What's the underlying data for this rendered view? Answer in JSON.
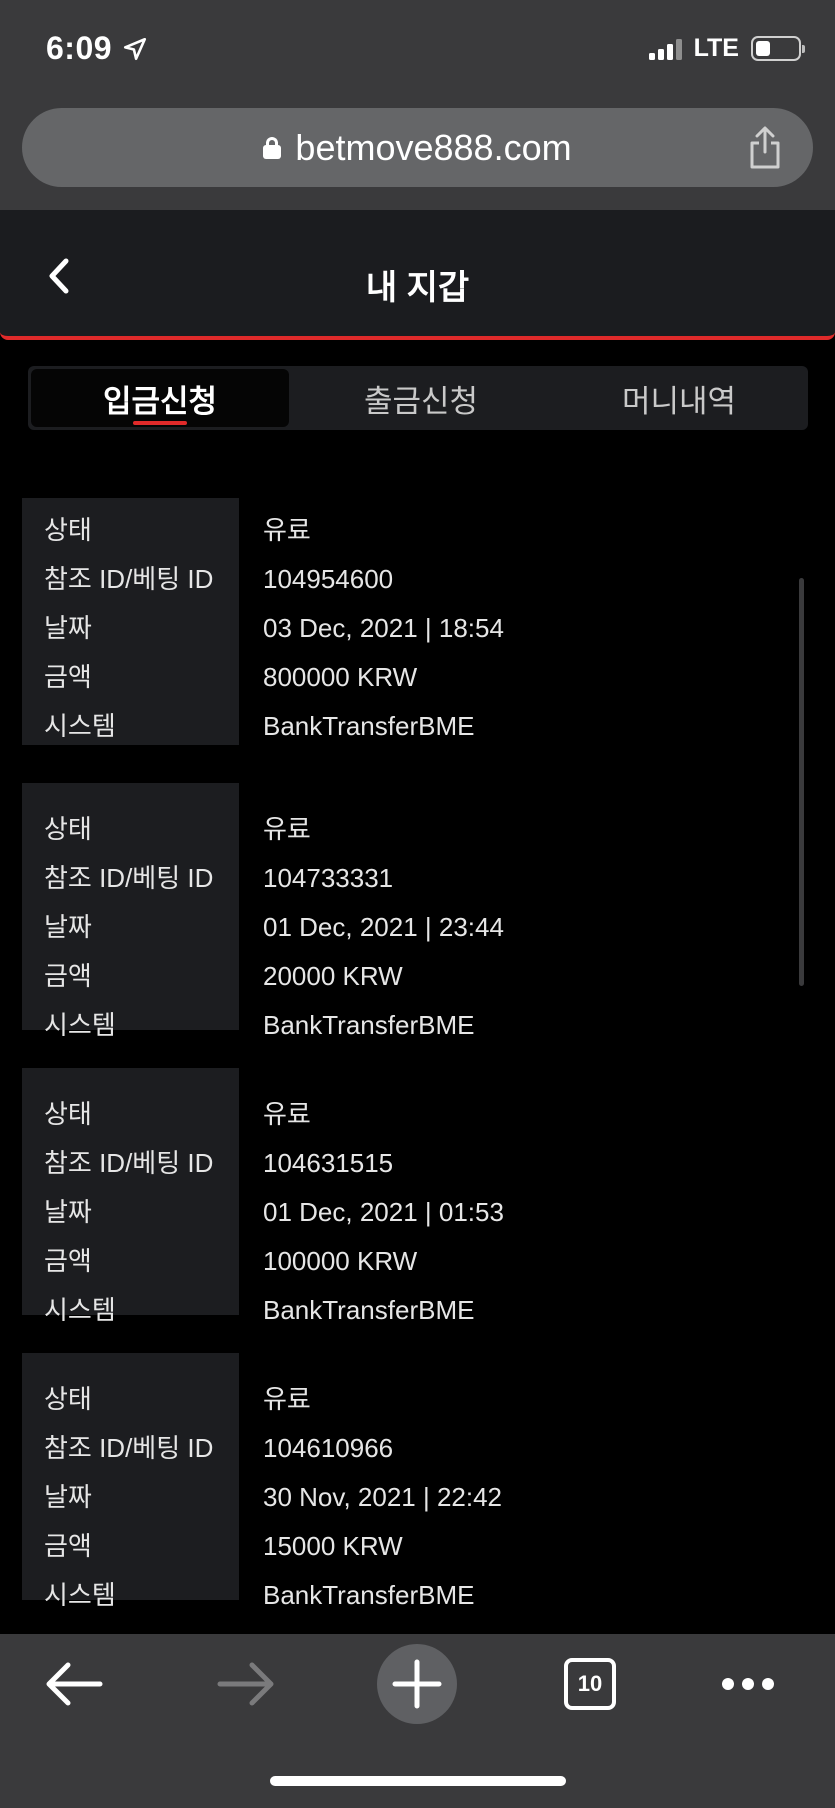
{
  "status_bar": {
    "time": "6:09",
    "network": "LTE"
  },
  "browser": {
    "url": "betmove888.com",
    "tab_count": "10"
  },
  "header": {
    "title": "내 지갑"
  },
  "tabs": [
    {
      "label": "입금신청",
      "active": true
    },
    {
      "label": "출금신청",
      "active": false
    },
    {
      "label": "머니내역",
      "active": false
    }
  ],
  "field_labels": {
    "status": "상태",
    "ref_id": "참조 ID/베팅 ID",
    "date": "날짜",
    "amount": "금액",
    "system": "시스템"
  },
  "records": [
    {
      "status": "유료",
      "ref_id": "104954600",
      "date": "03 Dec, 2021 | 18:54",
      "amount": "800000 KRW",
      "system": "BankTransferBME"
    },
    {
      "status": "유료",
      "ref_id": "104733331",
      "date": "01 Dec, 2021 | 23:44",
      "amount": "20000 KRW",
      "system": "BankTransferBME"
    },
    {
      "status": "유료",
      "ref_id": "104631515",
      "date": "01 Dec, 2021 | 01:53",
      "amount": "100000 KRW",
      "system": "BankTransferBME"
    },
    {
      "status": "유료",
      "ref_id": "104610966",
      "date": "30 Nov, 2021 | 22:42",
      "amount": "15000 KRW",
      "system": "BankTransferBME"
    }
  ],
  "colors": {
    "accent": "#e02a2a",
    "background": "#000000",
    "panel": "#1c1d20",
    "chrome": "#3a3a3c"
  }
}
